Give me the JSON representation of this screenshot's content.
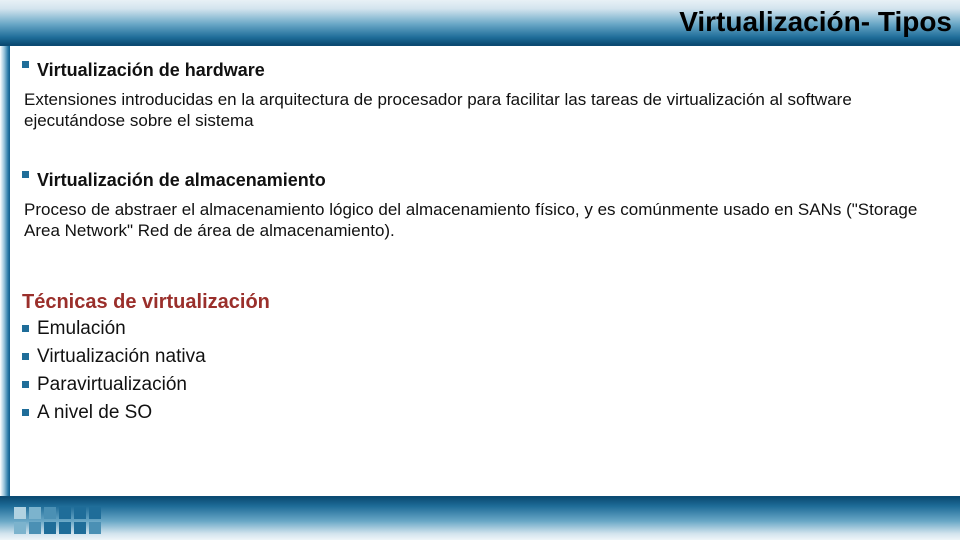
{
  "title": "Virtualización- Tipos",
  "sections": [
    {
      "heading": "Virtualización de hardware",
      "body": "Extensiones introducidas en la arquitectura de procesador para facilitar las tareas de virtualización al software ejecutándose sobre el sistema"
    },
    {
      "heading": "Virtualización de almacenamiento",
      "body": "Proceso de abstraer el almacenamiento lógico del almacenamiento físico, y es comúnmente usado en SANs (\"Storage Area Network\" Red de área de almacenamiento)."
    }
  ],
  "subheader": "Técnicas de virtualización",
  "techniques": [
    "Emulación",
    "Virtualización nativa",
    "Paravirtualización",
    "A nivel de SO"
  ]
}
